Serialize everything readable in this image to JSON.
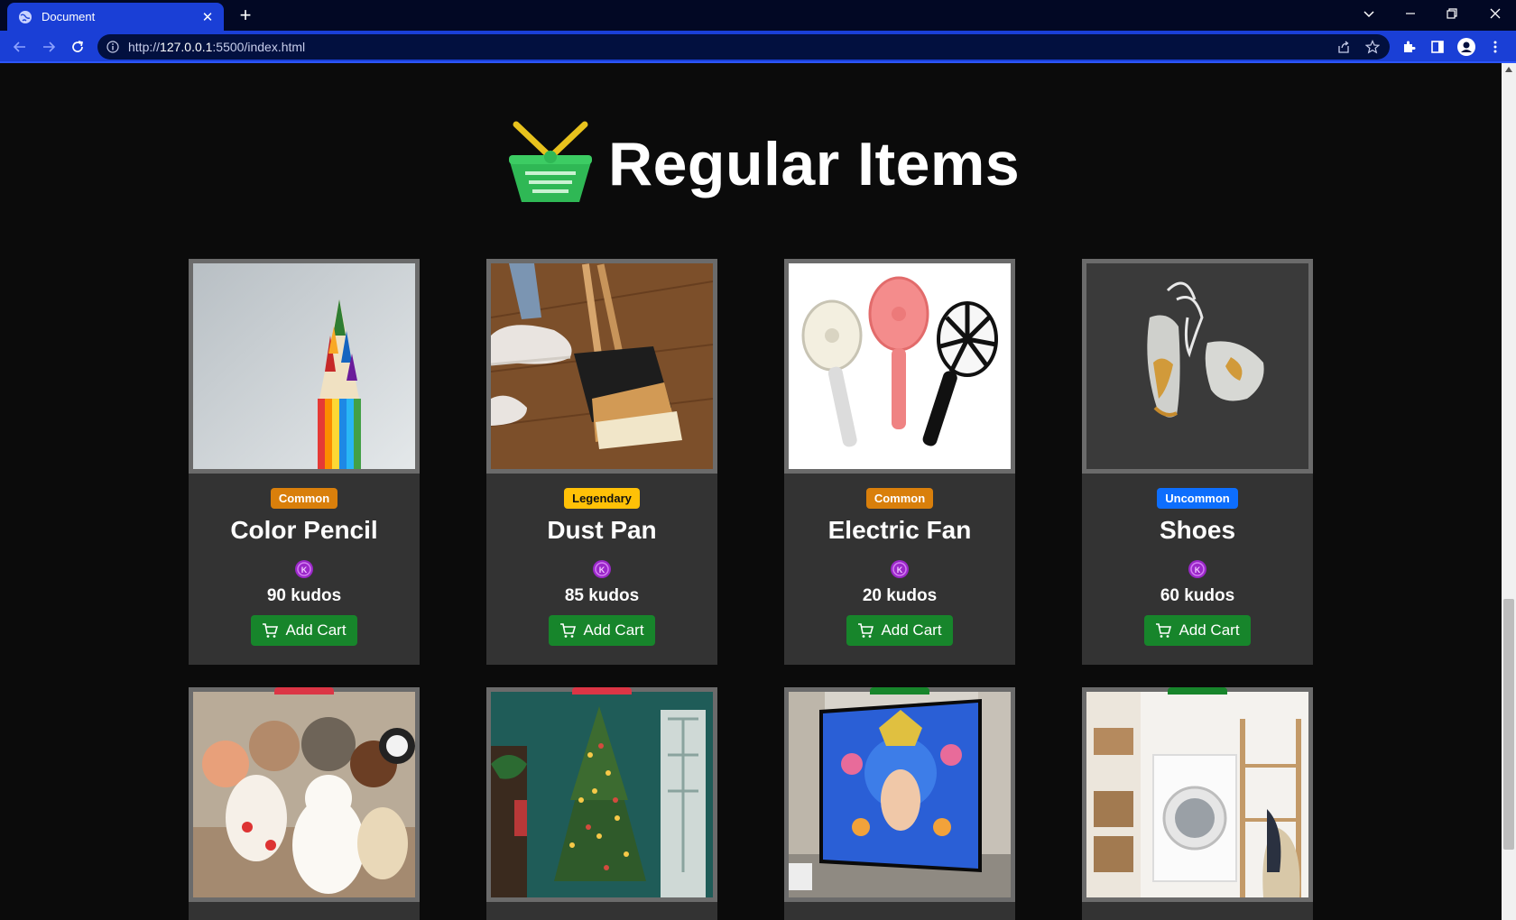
{
  "browser": {
    "tab_title": "Document",
    "url_prefix": "http://",
    "url_host": "127.0.0.1",
    "url_rest": ":5500/index.html"
  },
  "page": {
    "heading": "Regular Items"
  },
  "colors": {
    "background": "#0b0b0b",
    "card": "#333333",
    "common": "#d97f0b",
    "legendary": "#ffc107",
    "uncommon": "#0d6efd",
    "button": "#17852b",
    "coin": "#9b27c9"
  },
  "items": [
    {
      "rarity": "Common",
      "name": "Color Pencil",
      "price": "90 kudos",
      "button": "Add Cart"
    },
    {
      "rarity": "Legendary",
      "name": "Dust Pan",
      "price": "85 kudos",
      "button": "Add Cart"
    },
    {
      "rarity": "Common",
      "name": "Electric Fan",
      "price": "20 kudos",
      "button": "Add Cart"
    },
    {
      "rarity": "Uncommon",
      "name": "Shoes",
      "price": "60 kudos",
      "button": "Add Cart"
    }
  ]
}
